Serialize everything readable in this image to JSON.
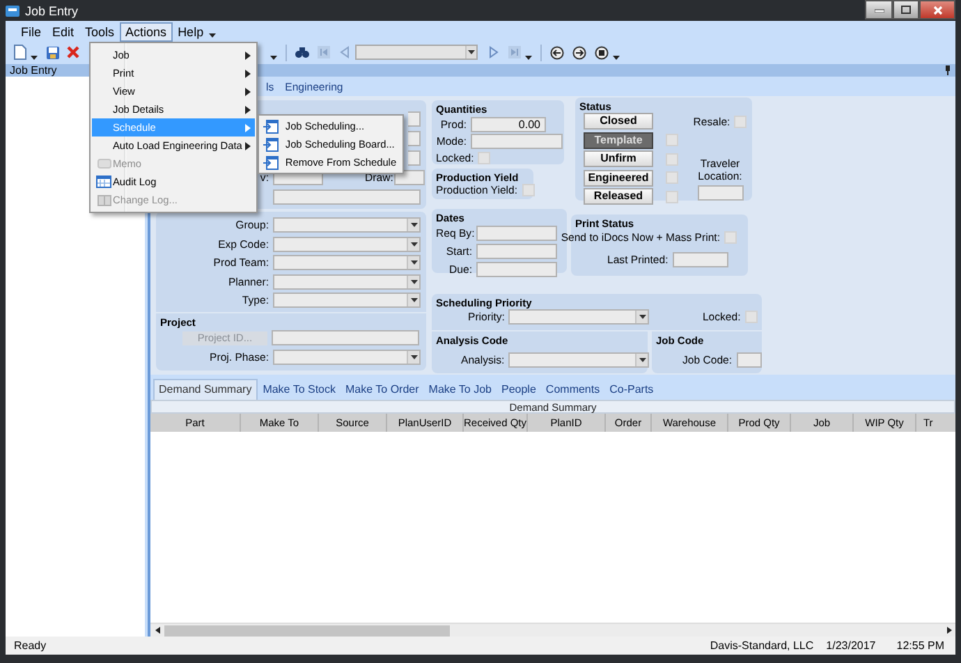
{
  "window": {
    "title": "Job Entry"
  },
  "menu_bar": [
    {
      "label": "File",
      "selected": false
    },
    {
      "label": "Edit",
      "selected": false
    },
    {
      "label": "Tools",
      "selected": false
    },
    {
      "label": "Actions",
      "selected": true
    },
    {
      "label": "Help",
      "selected": false
    }
  ],
  "actions_menu": {
    "items": [
      {
        "label": "Job",
        "submenu": true,
        "disabled": false,
        "selected": false
      },
      {
        "label": "Print",
        "submenu": true,
        "disabled": false,
        "selected": false
      },
      {
        "label": "View",
        "submenu": true,
        "disabled": false,
        "selected": false
      },
      {
        "label": "Job Details",
        "submenu": true,
        "disabled": false,
        "selected": false
      },
      {
        "label": "Schedule",
        "submenu": true,
        "disabled": false,
        "selected": true
      },
      {
        "label": "Auto Load Engineering Data",
        "submenu": true,
        "disabled": false,
        "selected": false
      },
      {
        "label": "Memo",
        "submenu": false,
        "disabled": true,
        "selected": false
      },
      {
        "label": "Audit Log",
        "submenu": false,
        "disabled": false,
        "selected": false
      },
      {
        "label": "Change Log...",
        "submenu": false,
        "disabled": true,
        "selected": false
      }
    ]
  },
  "schedule_submenu": {
    "items": [
      {
        "label": "Job Scheduling..."
      },
      {
        "label": "Job Scheduling Board..."
      },
      {
        "label": "Remove From Schedule"
      }
    ]
  },
  "panel_header": {
    "title": "Job Entry"
  },
  "upper_tabs": [
    {
      "label": "ls",
      "selected": false
    },
    {
      "label": "Engineering",
      "selected": false
    }
  ],
  "header_panel": {
    "revision_label": "v:",
    "drawing_label": "Draw:"
  },
  "quantities": {
    "title": "Quantities",
    "prod_label": "Prod:",
    "prod_value": "0.00",
    "mode_label": "Mode:",
    "locked_label": "Locked:",
    "locked": false
  },
  "production_yield": {
    "title": "Production Yield",
    "label": "Production Yield:",
    "checked": false
  },
  "status": {
    "title": "Status",
    "buttons": [
      {
        "label": "Closed",
        "selected": false
      },
      {
        "label": "Template",
        "selected": true,
        "checked": false
      },
      {
        "label": "Unfirm",
        "selected": false,
        "checked": false
      },
      {
        "label": "Engineered",
        "selected": false,
        "checked": false
      },
      {
        "label": "Released",
        "selected": false,
        "checked": false
      }
    ],
    "resale_label": "Resale:",
    "resale": false,
    "traveler_label": "Traveler Location:"
  },
  "group_panel": {
    "fields": [
      {
        "label": "Group:"
      },
      {
        "label": "Exp Code:"
      },
      {
        "label": "Prod Team:"
      },
      {
        "label": "Planner:"
      },
      {
        "label": "Type:"
      }
    ]
  },
  "project": {
    "title": "Project",
    "button": "Project ID...",
    "button_disabled": true,
    "phase_label": "Proj. Phase:"
  },
  "dates": {
    "title": "Dates",
    "fields": [
      {
        "label": "Req By:"
      },
      {
        "label": "Start:"
      },
      {
        "label": "Due:"
      }
    ]
  },
  "print_status": {
    "title": "Print Status",
    "send_label": "Send to iDocs Now + Mass Print:",
    "send": false,
    "last_printed_label": "Last Printed:"
  },
  "scheduling_priority": {
    "title": "Scheduling Priority",
    "priority_label": "Priority:",
    "locked_label": "Locked:",
    "locked": false
  },
  "analysis_code": {
    "title": "Analysis Code",
    "label": "Analysis:"
  },
  "job_code": {
    "title": "Job Code",
    "label": "Job Code:"
  },
  "lower_tabs": [
    {
      "label": "Demand Summary",
      "selected": true
    },
    {
      "label": "Make To Stock",
      "selected": false
    },
    {
      "label": "Make To Order",
      "selected": false
    },
    {
      "label": "Make To Job",
      "selected": false
    },
    {
      "label": "People",
      "selected": false
    },
    {
      "label": "Comments",
      "selected": false
    },
    {
      "label": "Co-Parts",
      "selected": false
    }
  ],
  "demand_grid": {
    "title": "Demand Summary",
    "columns": [
      "Part",
      "Make To",
      "Source",
      "PlanUserID",
      "Received Qty",
      "PlanID",
      "Order",
      "Warehouse",
      "Prod Qty",
      "Job",
      "WIP Qty",
      "Tr"
    ]
  },
  "status_bar": {
    "message": "Ready",
    "company": "Davis-Standard, LLC",
    "date": "1/23/2017",
    "time": "12:55 PM"
  }
}
